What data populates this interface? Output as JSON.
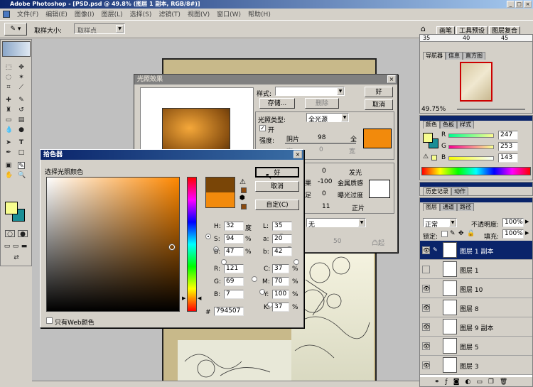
{
  "app": {
    "title": "Adobe Photoshop - [PSD.psd @ 49.8% (图层 1 副本, RGB/8#)]",
    "window_buttons": [
      "_",
      "□",
      "×"
    ]
  },
  "menu": [
    "文件(F)",
    "编辑(E)",
    "图像(I)",
    "图层(L)",
    "选择(S)",
    "滤镜(T)",
    "视图(V)",
    "窗口(W)",
    "帮助(H)"
  ],
  "options_bar": {
    "sample_size_label": "取样大小:",
    "sample_size_value": "取样点",
    "right_tabs": [
      "画笔",
      "工具预设",
      "图层复合"
    ]
  },
  "lighting_dialog": {
    "title": "光照效果",
    "style_label": "样式:",
    "save_btn": "存储...",
    "delete_btn": "删除",
    "ok_btn": "好",
    "cancel_btn": "取消",
    "light_type_label": "光照类型:",
    "light_type_value": "全光源",
    "on_label": "开",
    "intensity_label": "强度:",
    "intensity_left": "阴片",
    "intensity_value": "98",
    "intensity_right": "全",
    "focus_left": "窄",
    "focus_value": "0",
    "focus_right": "宽",
    "props": [
      {
        "left": "",
        "value": "0",
        "right": "发光"
      },
      {
        "left": "果",
        "value": "-100",
        "right": "金属质感"
      },
      {
        "left": "足",
        "value": "0",
        "right": "曝光过度"
      },
      {
        "left": "",
        "value": "11",
        "right": "正片"
      }
    ],
    "texture_value": "无",
    "height_value": "50",
    "height_right": "凸起",
    "light_color": "#f28a0c",
    "ambient_color": "#ffffff"
  },
  "color_picker": {
    "title": "拾色器",
    "heading": "选择光照颜色",
    "ok_btn": "好",
    "cancel_btn": "取消",
    "custom_btn": "自定(C)",
    "new_color": "#794507",
    "old_color": "#f28a0c",
    "hsb": [
      {
        "label": "H:",
        "value": "32",
        "unit": "度",
        "selected": true
      },
      {
        "label": "S:",
        "value": "94",
        "unit": "%",
        "selected": false
      },
      {
        "label": "B:",
        "value": "47",
        "unit": "%",
        "selected": false
      }
    ],
    "rgb": [
      {
        "label": "R:",
        "value": "121"
      },
      {
        "label": "G:",
        "value": "69"
      },
      {
        "label": "B:",
        "value": "7"
      }
    ],
    "lab": [
      {
        "label": "L:",
        "value": "35"
      },
      {
        "label": "a:",
        "value": "20"
      },
      {
        "label": "b:",
        "value": "42"
      }
    ],
    "cmyk": [
      {
        "label": "C:",
        "value": "37",
        "unit": "%"
      },
      {
        "label": "M:",
        "value": "70",
        "unit": "%"
      },
      {
        "label": "Y:",
        "value": "100",
        "unit": "%"
      },
      {
        "label": "K:",
        "value": "37",
        "unit": "%"
      }
    ],
    "hex_label": "#",
    "hex_value": "794507",
    "web_only_label": "只有Web颜色"
  },
  "navigator": {
    "tabs": [
      "导航器",
      "信息",
      "直方图"
    ],
    "ruler_ticks": [
      "35",
      "40",
      "45"
    ],
    "zoom": "49.75%"
  },
  "color_panel": {
    "tabs": [
      "颜色",
      "色板",
      "样式"
    ],
    "channels": [
      {
        "label": "R",
        "value": "247"
      },
      {
        "label": "G",
        "value": "253"
      },
      {
        "label": "B",
        "value": "143"
      }
    ]
  },
  "history_panel": {
    "tabs": [
      "历史记录",
      "动作"
    ]
  },
  "layers_panel": {
    "tabs": [
      "图层",
      "通道",
      "路径"
    ],
    "blend_mode": "正常",
    "opacity_label": "不透明度:",
    "opacity_value": "100%",
    "lock_label": "锁定:",
    "fill_label": "填充:",
    "fill_value": "100%",
    "layers": [
      {
        "name": "图层 1 副本",
        "selected": true
      },
      {
        "name": "图层 1",
        "selected": false
      },
      {
        "name": "图层 10",
        "selected": false
      },
      {
        "name": "图层 8",
        "selected": false
      },
      {
        "name": "图层 9 副本",
        "selected": false
      },
      {
        "name": "图层 5",
        "selected": false
      },
      {
        "name": "图层 3",
        "selected": false
      }
    ]
  },
  "colors": {
    "foreground": "#f7fd8f",
    "background": "#1a8e96",
    "selection": "#0a246a"
  }
}
